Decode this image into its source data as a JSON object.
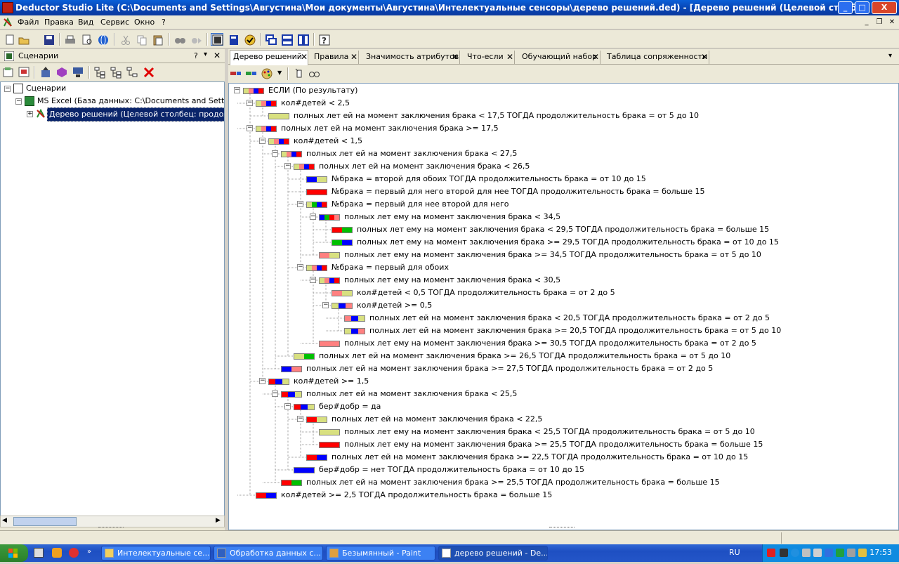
{
  "titlebar": {
    "title": "Deductor Studio Lite (C:\\Documents and Settings\\Августина\\Мои документы\\Августина\\Интелектуальные сенсоры\\дерево решений.ded) - [Дерево решений (Целевой столб]"
  },
  "menu": [
    "Файл",
    "Правка",
    "Вид",
    "Сервис",
    "Окно",
    "?"
  ],
  "left_panel": {
    "title": "Сценарии",
    "help": "?",
    "tree": [
      {
        "label": "Сценарии"
      },
      {
        "label": "MS Excel (База данных: C:\\Documents and Settings\\A"
      },
      {
        "label": "Дерево решений (Целевой столбец: продолжите"
      }
    ]
  },
  "tabs": [
    "Дерево решений",
    "Правила",
    "Значимость атрибутов",
    "Что-если",
    "Обучающий набор",
    "Таблица сопряженности"
  ],
  "colors": {
    "blue": "#0000ff",
    "red": "#ff0000",
    "green": "#00c000",
    "pink": "#ff8080",
    "khaki": "#d8e080",
    "accent": "#0a5fd8"
  },
  "tree": [
    {
      "label": "ЕСЛИ (По результату)",
      "segs": [
        "khaki",
        "pink",
        "blue",
        "red"
      ]
    },
    {
      "label": "кол#детей < 2,5",
      "segs": [
        "khaki",
        "pink",
        "blue",
        "red"
      ]
    },
    {
      "label": "полных лет ей на момент заключения брака < 17,5 ТОГДА продолжительность брака = от 5 до 10",
      "segs": [
        "khaki"
      ]
    },
    {
      "label": "полных лет ей на момент заключения брака >= 17,5",
      "segs": [
        "khaki",
        "pink",
        "blue",
        "red"
      ]
    },
    {
      "label": "кол#детей < 1,5",
      "segs": [
        "khaki",
        "pink",
        "blue",
        "red"
      ]
    },
    {
      "label": "полных лет ей на момент заключения брака < 27,5",
      "segs": [
        "khaki",
        "pink",
        "blue",
        "red"
      ]
    },
    {
      "label": "полных лет ей на момент заключения брака < 26,5",
      "segs": [
        "khaki",
        "pink",
        "blue",
        "red"
      ]
    },
    {
      "label": "№брака = второй для обоих ТОГДА продолжительность брака = от 10 до 15",
      "segs": [
        "blue",
        "khaki"
      ]
    },
    {
      "label": "№брака = первый для него второй для нее ТОГДА продолжительность брака = больше 15",
      "segs": [
        "red"
      ]
    },
    {
      "label": "№брака = первый для нее второй для него",
      "segs": [
        "khaki",
        "green",
        "blue",
        "red"
      ]
    },
    {
      "label": "полных лет ему на момент заключения брака < 34,5",
      "segs": [
        "blue",
        "green",
        "red",
        "pink"
      ]
    },
    {
      "label": "полных лет ему на момент заключения брака < 29,5 ТОГДА продолжительность брака = больше 15",
      "segs": [
        "red",
        "green"
      ]
    },
    {
      "label": "полных лет ему на момент заключения брака >= 29,5 ТОГДА продолжительность брака = от 10 до 15",
      "segs": [
        "green",
        "blue"
      ]
    },
    {
      "label": "полных лет ему на момент заключения брака >= 34,5 ТОГДА продолжительность брака = от 5 до 10",
      "segs": [
        "pink",
        "khaki"
      ]
    },
    {
      "label": "№брака = первый для обоих",
      "segs": [
        "khaki",
        "pink",
        "blue",
        "red"
      ]
    },
    {
      "label": "полных лет ему на момент заключения брака < 30,5",
      "segs": [
        "khaki",
        "pink",
        "blue",
        "red"
      ]
    },
    {
      "label": "кол#детей < 0,5 ТОГДА продолжительность брака = от 2 до 5",
      "segs": [
        "pink",
        "khaki"
      ]
    },
    {
      "label": "кол#детей >= 0,5",
      "segs": [
        "khaki",
        "blue",
        "pink"
      ]
    },
    {
      "label": "полных лет ей на момент заключения брака < 20,5 ТОГДА продолжительность брака = от 2 до 5",
      "segs": [
        "pink",
        "blue",
        "khaki"
      ]
    },
    {
      "label": "полных лет ей на момент заключения брака >= 20,5 ТОГДА продолжительность брака = от 5 до 10",
      "segs": [
        "khaki",
        "blue",
        "pink"
      ]
    },
    {
      "label": "полных лет ему на момент заключения брака >= 30,5 ТОГДА продолжительность брака = от 2 до 5",
      "segs": [
        "pink"
      ]
    },
    {
      "label": "полных лет ей на момент заключения брака >= 26,5 ТОГДА продолжительность брака = от 5 до 10",
      "segs": [
        "khaki",
        "green"
      ]
    },
    {
      "label": "полных лет ей на момент заключения брака >= 27,5 ТОГДА продолжительность брака = от 2 до 5",
      "segs": [
        "blue",
        "pink"
      ]
    },
    {
      "label": "кол#детей >= 1,5",
      "segs": [
        "red",
        "blue",
        "khaki"
      ]
    },
    {
      "label": "полных лет ей на момент заключения брака < 25,5",
      "segs": [
        "red",
        "blue",
        "khaki"
      ]
    },
    {
      "label": "бер#добр = да",
      "segs": [
        "red",
        "blue",
        "khaki"
      ]
    },
    {
      "label": "полных лет ей на момент заключения брака < 22,5",
      "segs": [
        "red",
        "khaki"
      ]
    },
    {
      "label": "полных лет ему на момент заключения брака < 25,5 ТОГДА продолжительность брака = от 5 до 10",
      "segs": [
        "khaki"
      ]
    },
    {
      "label": "полных лет ему на момент заключения брака >= 25,5 ТОГДА продолжительность брака = больше 15",
      "segs": [
        "red"
      ]
    },
    {
      "label": "полных лет ей на момент заключения брака >= 22,5 ТОГДА продолжительность брака = от 10 до 15",
      "segs": [
        "red",
        "blue"
      ]
    },
    {
      "label": "бер#добр = нет ТОГДА продолжительность брака = от 10 до 15",
      "segs": [
        "blue"
      ]
    },
    {
      "label": "полных лет ей на момент заключения брака >= 25,5 ТОГДА продолжительность брака = больше 15",
      "segs": [
        "red",
        "green"
      ]
    },
    {
      "label": "кол#детей >= 2,5 ТОГДА продолжительность брака = больше 15",
      "segs": [
        "red",
        "blue"
      ]
    }
  ],
  "taskbar": {
    "tasks": [
      "Интелектуальные се...",
      "Обработка данных с...",
      "Безымянный - Paint",
      "дерево решений - De..."
    ],
    "lang": "RU",
    "clock": "17:53"
  }
}
